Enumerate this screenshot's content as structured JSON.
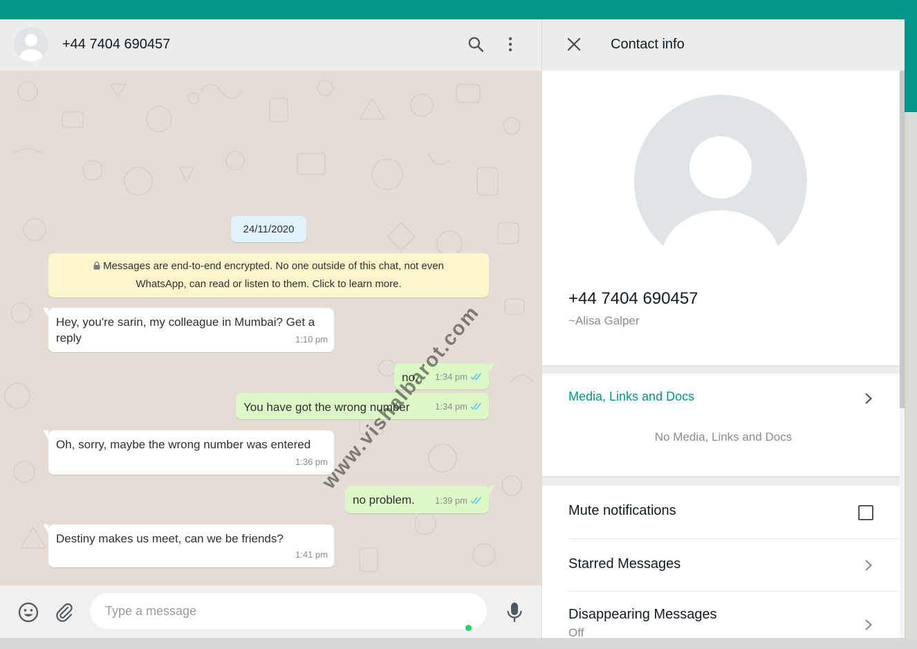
{
  "chat": {
    "contact_title": "+44 7404 690457",
    "date_label": "24/11/2020",
    "encryption_notice": {
      "line1": "Messages are end-to-end encrypted. No one outside of this chat, not even",
      "line2": "WhatsApp, can read or listen to them. Click to learn more."
    },
    "messages": [
      {
        "direction": "in",
        "text": "Hey, you're sarin, my colleague in Mumbai? Get a\nreply",
        "time": "1:10 pm"
      },
      {
        "direction": "out",
        "text": "no.",
        "time": "1:34 pm"
      },
      {
        "direction": "out",
        "text": "You have got the wrong number",
        "time": "1:34 pm"
      },
      {
        "direction": "in",
        "text": "Oh, sorry, maybe the wrong number was entered",
        "time": "1:36 pm"
      },
      {
        "direction": "out",
        "text": "no problem.",
        "time": "1:39 pm"
      },
      {
        "direction": "in",
        "text": "Destiny makes us meet, can we be friends?",
        "time": "1:41 pm"
      }
    ],
    "composer_placeholder": "Type a message",
    "watermark": "www.vishalbarot.com"
  },
  "contact_info": {
    "title": "Contact info",
    "number": "+44 7404 690457",
    "name": "~Alisa Galper",
    "media_label": "Media, Links and Docs",
    "media_empty": "No Media, Links and Docs",
    "mute_label": "Mute notifications",
    "starred_label": "Starred Messages",
    "disappearing_label": "Disappearing Messages",
    "disappearing_value": "Off"
  },
  "icons": {
    "avatar": "default-avatar-icon",
    "search": "search-icon",
    "menu": "kebab-menu-icon",
    "close": "close-icon",
    "emoji": "emoji-icon",
    "attach": "paperclip-icon",
    "mic": "microphone-icon",
    "lock": "lock-icon",
    "read_receipt": "double-check-icon",
    "chevron": "chevron-right-icon"
  },
  "colors": {
    "brand_teal": "#009688",
    "outgoing_bubble": "#dcf8c6",
    "incoming_bubble": "#ffffff",
    "chat_background": "#e5ddd5",
    "encryption_notice_bg": "#fcf4cb",
    "date_pill_bg": "#e1f2fb",
    "read_tick": "#4fc3f7",
    "online_dot": "#25d366"
  }
}
